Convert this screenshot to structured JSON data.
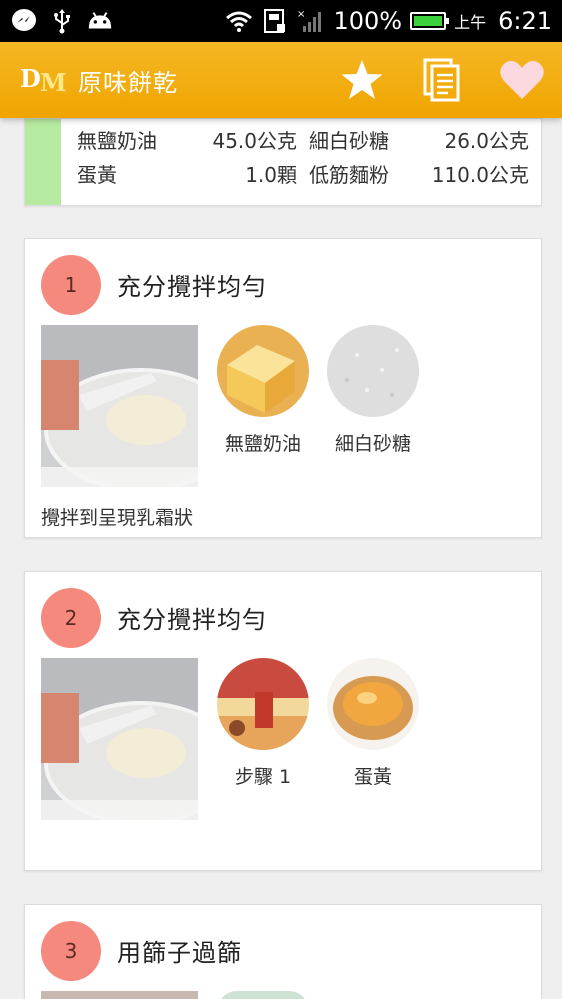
{
  "status_bar": {
    "battery": "100%",
    "time_prefix": "上午",
    "time": "6:21"
  },
  "app_bar": {
    "logo_text": "DM",
    "title": "原味餅乾",
    "actions": [
      "favorite-star",
      "recipe-list",
      "like-heart"
    ]
  },
  "ingredients": {
    "accent_color": "#b7eaa1",
    "rows": [
      {
        "name1": "無鹽奶油",
        "amount1": "45.0公克",
        "name2": "細白砂糖",
        "amount2": "26.0公克"
      },
      {
        "name1": "蛋黃",
        "amount1": "1.0顆",
        "name2": "低筋麵粉",
        "amount2": "110.0公克"
      }
    ]
  },
  "steps": [
    {
      "number": "1",
      "title": "充分攪拌均勻",
      "items": [
        "無鹽奶油",
        "細白砂糖"
      ],
      "description": "攪拌到呈現乳霜狀"
    },
    {
      "number": "2",
      "title": "充分攪拌均勻",
      "items": [
        "步驟 1",
        "蛋黃"
      ],
      "description": ""
    },
    {
      "number": "3",
      "title": "用篩子過篩"
    }
  ],
  "colors": {
    "app_bar": "#f0a500",
    "step_badge": "#f6897e",
    "background": "#efefef"
  }
}
